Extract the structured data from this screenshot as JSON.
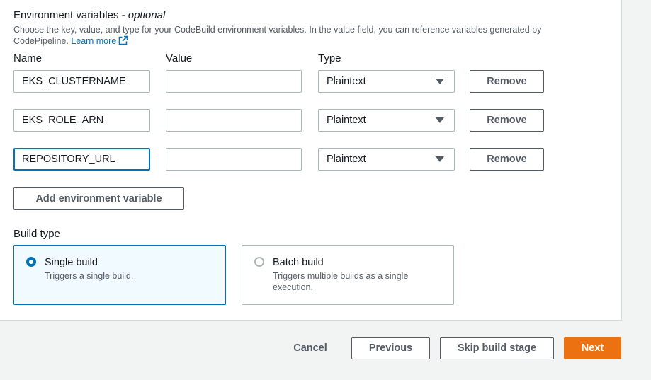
{
  "env": {
    "title": "Environment variables - ",
    "title_optional": "optional",
    "description": "Choose the key, value, and type for your CodeBuild environment variables. In the value field, you can reference variables generated by CodePipeline.",
    "learn_more": "Learn more",
    "columns": {
      "name": "Name",
      "value": "Value",
      "type": "Type"
    },
    "rows": [
      {
        "name": "EKS_CLUSTERNAME",
        "value": "",
        "type": "Plaintext",
        "remove": "Remove"
      },
      {
        "name": "EKS_ROLE_ARN",
        "value": "",
        "type": "Plaintext",
        "remove": "Remove"
      },
      {
        "name": "REPOSITORY_URL",
        "value": "",
        "type": "Plaintext",
        "remove": "Remove"
      }
    ],
    "add_button": "Add environment variable"
  },
  "build_type": {
    "label": "Build type",
    "options": [
      {
        "title": "Single build",
        "description": "Triggers a single build.",
        "selected": true
      },
      {
        "title": "Batch build",
        "description": "Triggers multiple builds as a single execution.",
        "selected": false
      }
    ]
  },
  "footer": {
    "cancel": "Cancel",
    "previous": "Previous",
    "skip": "Skip build stage",
    "next": "Next"
  },
  "colors": {
    "accent": "#0073bb",
    "primary_button": "#ec7211",
    "background": "#f2f3f3"
  },
  "icons": {
    "learn_more": "external-link-icon"
  }
}
